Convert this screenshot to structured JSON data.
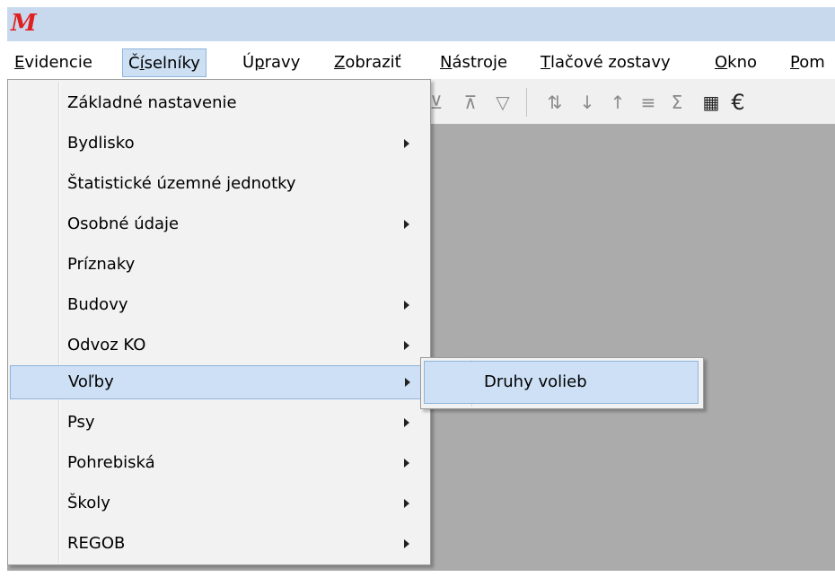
{
  "app": {
    "logo_text": "M",
    "logo_color": "#e02020",
    "titlebar_color": "#c8d9ee",
    "mdi_background": "#ababab"
  },
  "menubar": {
    "items": [
      {
        "label_underlined": "E",
        "label_rest": "videncie"
      },
      {
        "label_pre": "Č",
        "label_underlined": "í",
        "label_rest": "selníky",
        "active": true
      },
      {
        "label_pre": "Ú",
        "label_underlined": "p",
        "label_rest": "ravy"
      },
      {
        "label_underlined": "Z",
        "label_rest": "obraziť"
      },
      {
        "label_underlined": "N",
        "label_rest": "ástroje"
      },
      {
        "label_underlined": "T",
        "label_rest": "lačové zostavy"
      },
      {
        "label_underlined": "O",
        "label_rest": "kno"
      },
      {
        "label_underlined": "P",
        "label_rest": "om"
      }
    ]
  },
  "toolbar": {
    "icons": [
      {
        "name": "filter-partial-icon",
        "glyph": "⊻"
      },
      {
        "name": "clear-filter-icon",
        "glyph": "⊼"
      },
      {
        "name": "filter-icon",
        "glyph": "▽"
      },
      {
        "name": "sort-ascending-icon",
        "glyph": "⇅"
      },
      {
        "name": "sort-az-icon",
        "glyph": "↓"
      },
      {
        "name": "sort-za-icon",
        "glyph": "↑"
      },
      {
        "name": "columns-icon",
        "glyph": "≡"
      },
      {
        "name": "sum-icon",
        "glyph": "Σ"
      },
      {
        "name": "calculator-icon",
        "glyph": "▦"
      },
      {
        "name": "euro-icon",
        "glyph": "€"
      }
    ]
  },
  "dropdown": {
    "items": [
      {
        "label": "Základné nastavenie",
        "submenu": false
      },
      {
        "label": "Bydlisko",
        "submenu": true
      },
      {
        "label": "Štatistické územné jednotky",
        "submenu": false
      },
      {
        "label": "Osobné údaje",
        "submenu": true
      },
      {
        "label": "Príznaky",
        "submenu": false
      },
      {
        "label": "Budovy",
        "submenu": true
      },
      {
        "label": "Odvoz KO",
        "submenu": true
      },
      {
        "label": "Voľby",
        "submenu": true,
        "hover": true
      },
      {
        "label": "Psy",
        "submenu": true
      },
      {
        "label": "Pohrebiská",
        "submenu": true
      },
      {
        "label": "Školy",
        "submenu": true
      },
      {
        "label": "REGOB",
        "submenu": true
      }
    ]
  },
  "submenu": {
    "items": [
      {
        "label": "Druhy volieb"
      }
    ]
  }
}
